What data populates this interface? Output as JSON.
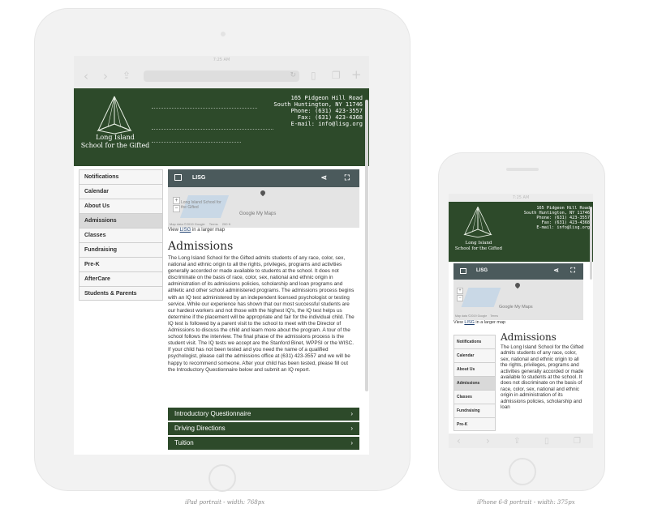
{
  "captions": {
    "ipad": "iPad portrait - width: 768px",
    "iphone": "iPhone 6-8 portrait - width: 375px"
  },
  "ipad": {
    "status_time": "7:25 AM",
    "header": {
      "school_name_line1": "Long Island",
      "school_name_line2": "School for the Gifted",
      "address_line1": "165 Pidgeon Hill Road",
      "address_line2": "South Huntington, NY 11746",
      "phone": "Phone: (631) 423-3557",
      "fax": "Fax: (631) 423-4368",
      "email": "E-mail: info@lisg.org"
    },
    "nav": [
      "Notifications",
      "Calendar",
      "About Us",
      "Admissions",
      "Classes",
      "Fundraising",
      "Pre-K",
      "AfterCare",
      "Students & Parents"
    ],
    "map": {
      "label": "LISG",
      "place": "Long Island School for the Gifted",
      "attribution": "Map data ©2019 Google",
      "terms": "Terms",
      "scale": "200 ft",
      "brand": "Google My Maps",
      "view_prefix": "View ",
      "view_link": "LISG",
      "view_suffix": " in a larger map"
    },
    "page_title": "Admissions",
    "paragraph": "The Long Island School for the Gifted admits students of any race, color, sex, national and ethnic origin to all the rights, privileges, programs and activities generally accorded or made available to students at the school. It does not discriminate on the basis of race, color, sex, national and ethnic origin in administration of its admissions policies, scholarship and loan programs and athletic and other school administered programs. The admissions process begins with an IQ test administered by an independent licensed psychologist or testing service. While our experience has shown that our most successful students are our hardest workers and not those with the highest IQ's, the IQ test helps us determine if the placement will be appropriate and fair for the individual child. The IQ test is followed by a parent visit to the school to meet with the Director of Admissions to discuss the child and learn more about the program. A tour of the school follows the interview. The final phase of the admissions process is the student visit. The IQ tests we accept are the Stanford Binet, WPPSI or the WISC. If your child has not been tested and you need the name of a qualified psychologist, please call the admissions office at (631) 423-3557 and we will be happy to recommend someone. After your child has been tested, please fill out the Introductory Questionnaire below and submit an IQ report.",
    "accordion": [
      "Introductory Questionnaire",
      "Driving Directions",
      "Tuition"
    ]
  },
  "iphone": {
    "status_time": "7:25 AM",
    "header": {
      "school_name_line1": "Long Island",
      "school_name_line2": "School for the Gifted",
      "address_line1": "165 Pidgeon Hill Road",
      "address_line2": "South Huntington, NY 11746",
      "phone": "Phone: (631) 423-3557",
      "fax": "Fax: (631) 423-4368",
      "email": "E-mail: info@lisg.org"
    },
    "nav": [
      "Notifications",
      "Calendar",
      "About Us",
      "Admissions",
      "Classes",
      "Fundraising",
      "Pre-K"
    ],
    "map": {
      "label": "LISG",
      "attribution": "Map data ©2019 Google",
      "terms": "Terms",
      "brand": "Google My Maps",
      "view_prefix": "View ",
      "view_link": "LISG",
      "view_suffix": " in a larger map"
    },
    "page_title": "Admissions",
    "paragraph": "The Long Island School for the Gifted admits students of any race, color, sex, national and ethnic origin to all the rights, privileges, programs and activities generally accorded or made available to students at the school. It does not discriminate on the basis of race, color, sex, national and ethnic origin in administration of its admissions policies, scholarship and loan"
  },
  "colors": {
    "header_green": "#2d4a2a",
    "map_bar": "#4b5a5c",
    "active_nav": "#d9d9d9"
  }
}
